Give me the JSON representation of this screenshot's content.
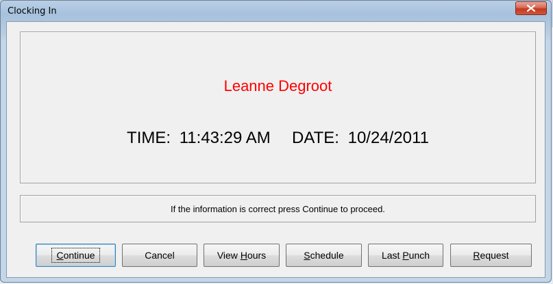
{
  "window": {
    "title": "Clocking In",
    "close_glyph": "✕"
  },
  "info": {
    "employee_name": "Leanne Degroot",
    "time_label": "TIME:",
    "time_value": "11:43:29 AM",
    "date_label": "DATE:",
    "date_value": "10/24/2011",
    "name_color": "#ff0000"
  },
  "message": {
    "text": "If the information is correct press Continue to proceed."
  },
  "buttons": {
    "continue": {
      "mnemonic": "C",
      "rest": "ontinue"
    },
    "cancel": {
      "label": "Cancel"
    },
    "view_hours": {
      "pre": "View ",
      "mnemonic": "H",
      "rest": "ours"
    },
    "schedule": {
      "mnemonic": "S",
      "rest": "chedule"
    },
    "last_punch": {
      "pre": "Last ",
      "mnemonic": "P",
      "rest": "unch"
    },
    "request": {
      "mnemonic": "R",
      "rest": "equest"
    }
  }
}
